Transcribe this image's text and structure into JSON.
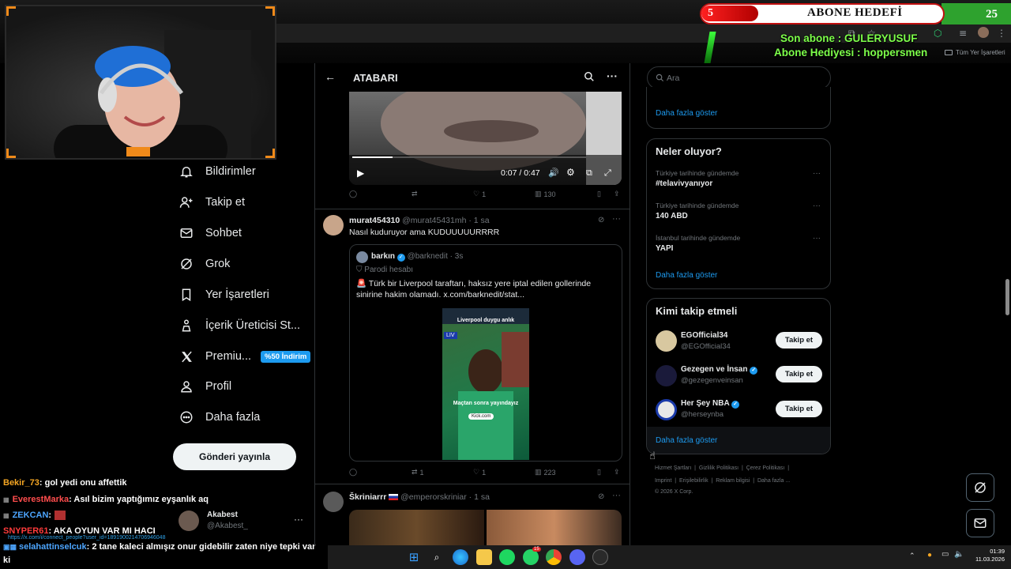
{
  "overlay": {
    "sub_current": "5",
    "sub_title": "ABONE HEDEFİ",
    "sub_goal": "25",
    "last_sub": "Son abone : GULERYUSUF",
    "gift_sub": "Abone Hediyesi : hoppersmen",
    "bookmarks_label": "Tüm Yer İşaretleri"
  },
  "nav": {
    "items": [
      {
        "label": "Bildirimler",
        "icon": "bell-icon"
      },
      {
        "label": "Takip et",
        "icon": "person-add-icon"
      },
      {
        "label": "Sohbet",
        "icon": "mail-icon"
      },
      {
        "label": "Grok",
        "icon": "grok-icon"
      },
      {
        "label": "Yer İşaretleri",
        "icon": "bookmark-icon"
      },
      {
        "label": "İçerik Üreticisi St...",
        "icon": "creator-icon"
      },
      {
        "label": "Premiu...",
        "icon": "x-logo-icon"
      },
      {
        "label": "Profil",
        "icon": "person-icon"
      },
      {
        "label": "Daha fazla",
        "icon": "more-circle-icon"
      }
    ],
    "premium_badge": "%50 İndirim",
    "post_button": "Gönderi yayınla",
    "account_name": "Akabest",
    "account_handle": "@Akabest_",
    "status_url": "https://x.com/i/connect_people?user_id=1891900214706946048"
  },
  "chat": [
    {
      "user": "Bekir_73",
      "color": "#f5a623",
      "msg": ": gol yedi onu affettik"
    },
    {
      "user": "EverestMarka",
      "color": "#ff4d4d",
      "msg": ": Asıl bizim yaptığımız eyşanlık aq"
    },
    {
      "user": "ZEKCAN",
      "color": "#4da6ff",
      "msg": ":"
    },
    {
      "user": "SNYPER61",
      "color": "#ff3b3b",
      "msg": ": AKA OYUN VAR MI HACI"
    },
    {
      "user": "selahattinselcuk",
      "color": "#4da6ff",
      "msg": ": 2 tane kaleci almışız onur gidebilir zaten niye tepki var"
    },
    {
      "user": "",
      "color": "#ffffff",
      "msg": "ki"
    }
  ],
  "main": {
    "header_title": "ATABARI",
    "video_time": "0:07 / 0:47",
    "video_progress": 0.15,
    "tweet1_stats": {
      "reply": "",
      "retweet": "",
      "like": "1",
      "views": "130"
    },
    "tweet2": {
      "name": "murat454310",
      "handle": "@murat45431mh",
      "time": "· 1 sa",
      "text": "Nasıl kuduruyor ama KUDUUUUURRRR",
      "quote": {
        "name": "barkın",
        "handle": "@barknedit",
        "time": "· 3s",
        "parody": "Parodi hesabı",
        "text": "🚨 Türk bir Liverpool taraftarı, haksız yere iptal edilen gollerinde sinirine hakim olamadı.",
        "link": "x.com/barknedit/stat...",
        "video_caption_top": "Liverpool duygu anlık",
        "video_tag": "LIV",
        "video_caption_mid": "Maçtan sonra yayındayız",
        "video_kick": "Kick.com"
      },
      "stats": {
        "reply": "",
        "retweet": "1",
        "like": "1",
        "views": "223"
      }
    },
    "tweet3": {
      "name": "Škriniarrr",
      "handle": "@emperorskriniar",
      "time": "· 1 sa"
    }
  },
  "right": {
    "search_placeholder": "Ara",
    "prev_show_more": "Daha fazla göster",
    "trends_title": "Neler oluyor?",
    "trends": [
      {
        "cat": "Türkiye tarihinde gündemde",
        "title": "#telavivyanıyor"
      },
      {
        "cat": "Türkiye tarihinde gündemde",
        "title": "140 ABD"
      },
      {
        "cat": "İstanbul tarihinde gündemde",
        "title": "YAPI"
      }
    ],
    "trends_more": "Daha fazla göster",
    "who_title": "Kimi takip etmeli",
    "who": [
      {
        "name": "EGOfficial34",
        "handle": "@EGOfficial34",
        "verified": false,
        "button": "Takip et"
      },
      {
        "name": "Gezegen ve İnsan",
        "handle": "@gezegenveinsan",
        "verified": true,
        "button": "Takip et"
      },
      {
        "name": "Her Şey NBA",
        "handle": "@herseynba",
        "verified": true,
        "button": "Takip et"
      }
    ],
    "who_more": "Daha fazla göster",
    "footer_row1": [
      "Hizmet Şartları",
      "Gizlilik Politikası",
      "Çerez Politikası"
    ],
    "footer_row2": [
      "Imprint",
      "Erişilebilirlik",
      "Reklam bilgisi",
      "Daha fazla ..."
    ],
    "copyright": "© 2026 X Corp."
  },
  "taskbar": {
    "time": "01:39",
    "date": "11.03.2026",
    "whatsapp_badge": "15"
  },
  "colors": {
    "accent": "#1d9bf0",
    "overlay_green": "#7dff4a",
    "overlay_red": "#e01818"
  }
}
